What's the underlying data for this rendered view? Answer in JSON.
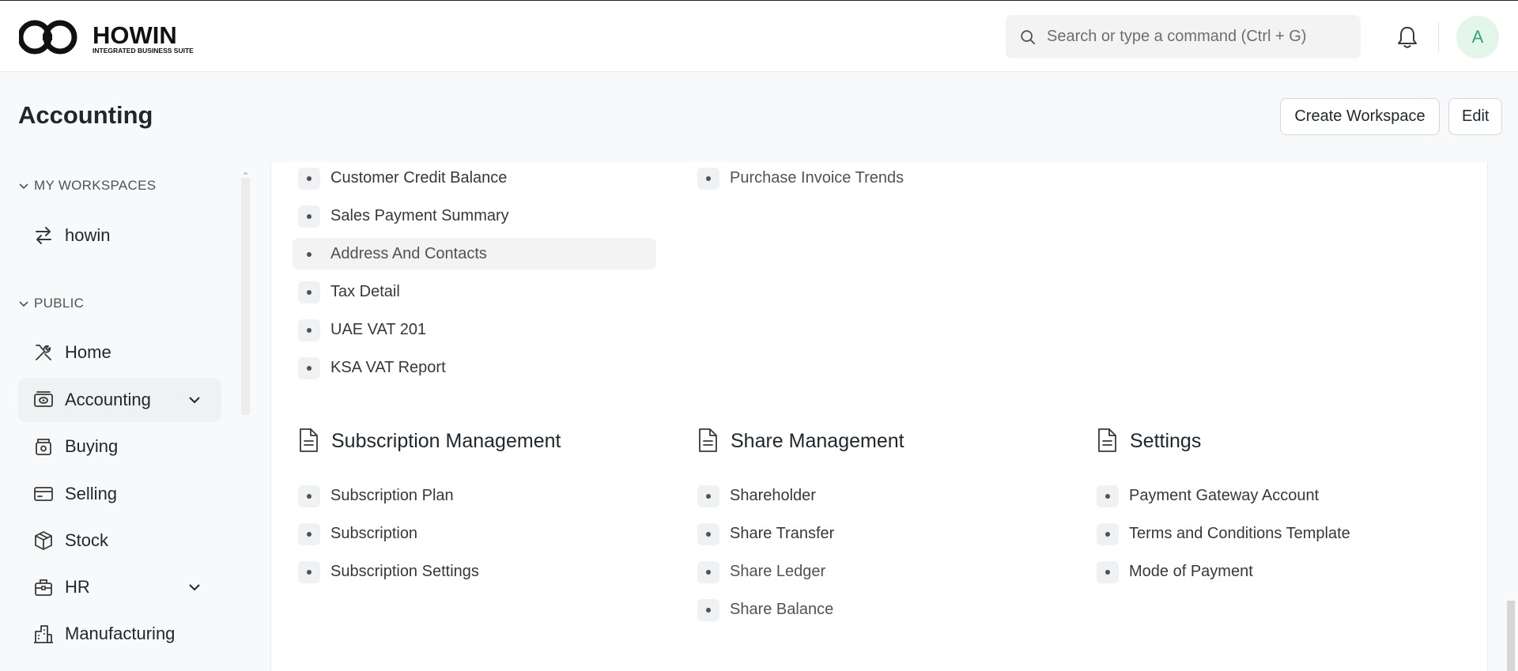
{
  "brand": {
    "name": "HOWIN",
    "tagline": "INTEGRATED BUSINESS SUITE"
  },
  "search": {
    "placeholder": "Search or type a command (Ctrl + G)"
  },
  "user": {
    "initial": "A"
  },
  "page": {
    "title": "Accounting"
  },
  "actions": {
    "create_workspace": "Create Workspace",
    "edit": "Edit"
  },
  "sidebar": {
    "my_workspaces_label": "MY WORKSPACES",
    "public_label": "PUBLIC",
    "workspaces": [
      {
        "label": "howin",
        "icon": "switch-arrows-icon"
      }
    ],
    "items": [
      {
        "label": "Home",
        "icon": "tools-icon"
      },
      {
        "label": "Accounting",
        "icon": "accounting-icon",
        "active": true,
        "expandable": true
      },
      {
        "label": "Buying",
        "icon": "buying-icon"
      },
      {
        "label": "Selling",
        "icon": "selling-icon"
      },
      {
        "label": "Stock",
        "icon": "stock-icon"
      },
      {
        "label": "HR",
        "icon": "hr-icon",
        "expandable": true
      },
      {
        "label": "Manufacturing",
        "icon": "manufacturing-icon"
      }
    ]
  },
  "reports_col1": [
    "Customer Credit Balance",
    "Sales Payment Summary",
    "Address And Contacts",
    "Tax Detail",
    "UAE VAT 201",
    "KSA VAT Report"
  ],
  "reports_col2": [
    "Purchase Invoice Trends"
  ],
  "sections": [
    {
      "title": "Subscription Management",
      "links": [
        "Subscription Plan",
        "Subscription",
        "Subscription Settings"
      ]
    },
    {
      "title": "Share Management",
      "links": [
        "Shareholder",
        "Share Transfer",
        "Share Ledger",
        "Share Balance"
      ]
    },
    {
      "title": "Settings",
      "links": [
        "Payment Gateway Account",
        "Terms and Conditions Template",
        "Mode of Payment"
      ]
    }
  ],
  "colors": {
    "accent": "#30a66d",
    "active_bg": "#f0f1f2",
    "text": "#1f272e"
  }
}
